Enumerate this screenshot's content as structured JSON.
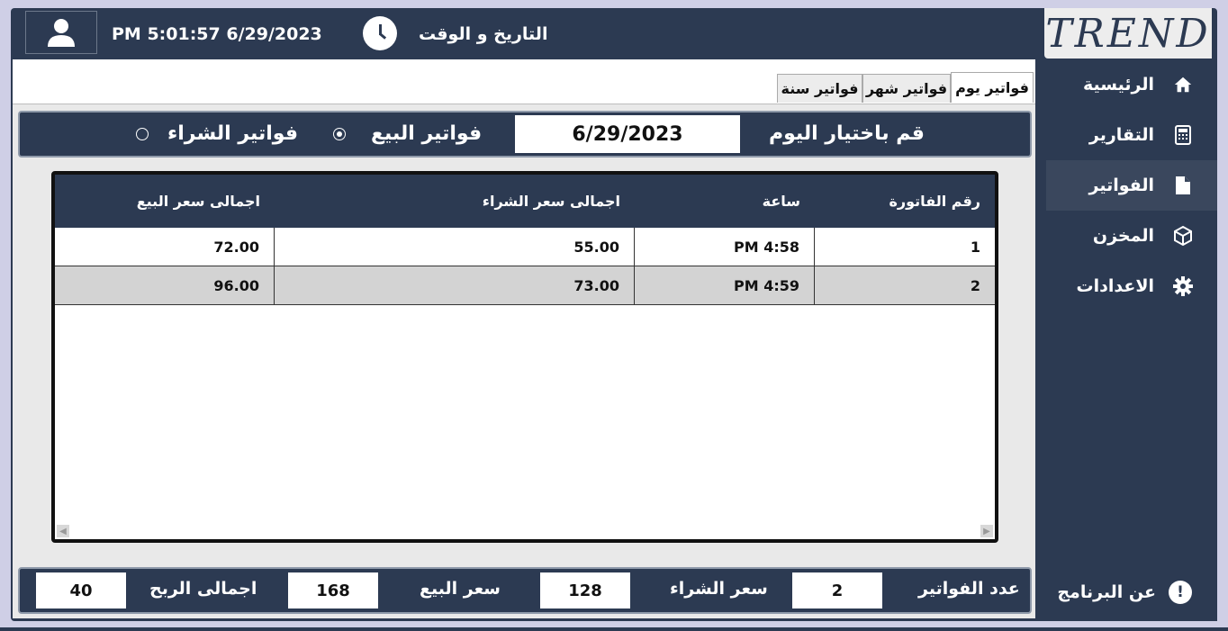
{
  "header": {
    "datetime": "PM 5:01:57 6/29/2023",
    "datetime_label": "التاريخ و الوقت",
    "logo_text": "TREND",
    "icons": [
      "user-icon",
      "clock-icon"
    ]
  },
  "tabs": [
    {
      "label": "فواتير يوم",
      "active": true
    },
    {
      "label": "فواتير شهر",
      "active": false
    },
    {
      "label": "فواتير سنة",
      "active": false
    }
  ],
  "filter": {
    "prompt": "قم باختيار اليوم",
    "date": "6/29/2023",
    "sales_label": "فواتير البيع",
    "purchases_label": "فواتير الشراء",
    "selected": "sales"
  },
  "table": {
    "columns": [
      "رقم الفاتورة",
      "ساعة",
      "اجمالى سعر الشراء",
      "اجمالى سعر البيع"
    ],
    "rows": [
      {
        "number": "1",
        "time": "PM 4:58",
        "purchase_total": "55.00",
        "sale_total": "72.00"
      },
      {
        "number": "2",
        "time": "PM 4:59",
        "purchase_total": "73.00",
        "sale_total": "96.00"
      }
    ]
  },
  "summary": {
    "invoice_count_label": "عدد الفواتير",
    "invoice_count": "2",
    "purchase_label": "سعر الشراء",
    "purchase_value": "128",
    "sale_label": "سعر البيع",
    "sale_value": "168",
    "profit_label": "اجمالى الربح",
    "profit_value": "40"
  },
  "sidebar": {
    "items": [
      {
        "label": "الرئيسية",
        "icon": "home-icon",
        "active": false
      },
      {
        "label": "التقارير",
        "icon": "calculator-icon",
        "active": false
      },
      {
        "label": "الفواتير",
        "icon": "document-icon",
        "active": true
      },
      {
        "label": "المخزن",
        "icon": "box-icon",
        "active": false
      },
      {
        "label": "الاعدادات",
        "icon": "gear-icon",
        "active": false
      }
    ],
    "about_label": "عن البرنامج",
    "about_icon_glyph": "!"
  },
  "colors": {
    "primary": "#2c3a52",
    "content_bg": "#e9e9e9",
    "row_alt": "#d3d3d3"
  }
}
